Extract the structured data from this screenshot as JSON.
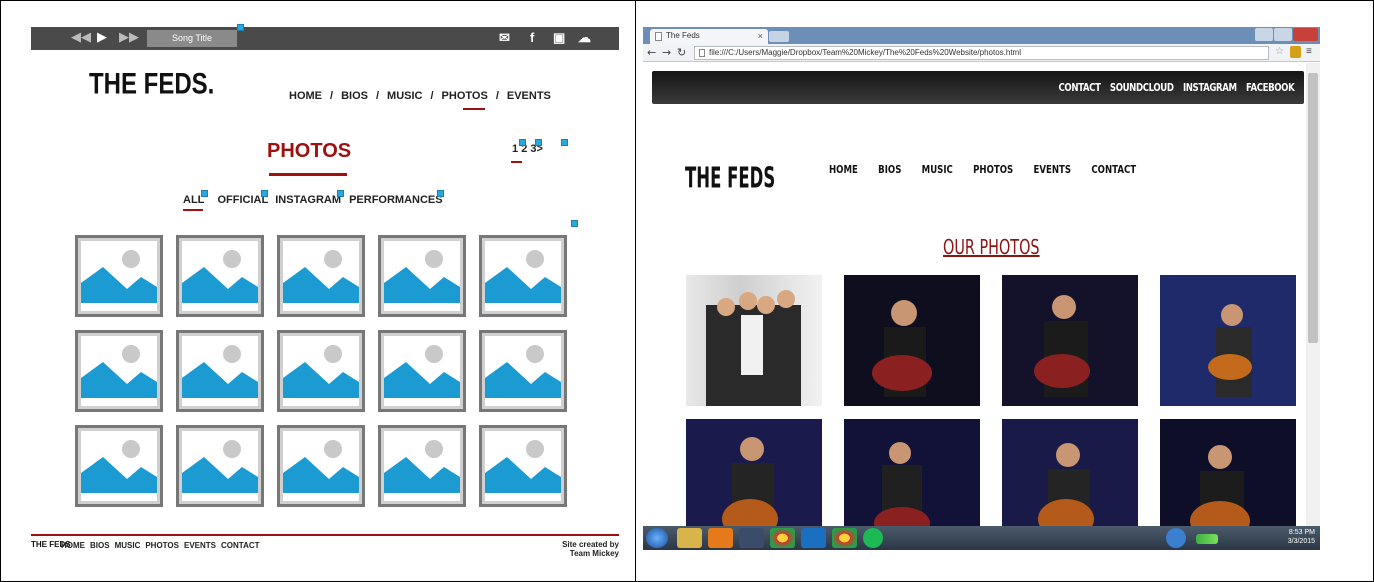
{
  "wireframe": {
    "player": {
      "song_title": "Song Title"
    },
    "logo": "THE FEDS.",
    "nav": [
      "HOME",
      "BIOS",
      "MUSIC",
      "PHOTOS",
      "EVENTS"
    ],
    "nav_separator": "/",
    "title": "PHOTOS",
    "pagination": {
      "pages": [
        "1",
        "2",
        "3"
      ],
      "next": ">"
    },
    "filters": [
      "ALL",
      "OFFICIAL",
      "INSTAGRAM",
      "PERFORMANCES"
    ],
    "footer": {
      "logo": "THE FEDS",
      "nav": [
        "HOME",
        "BIOS",
        "MUSIC",
        "PHOTOS",
        "EVENTS",
        "CONTACT"
      ],
      "credit_line1": "Site created by",
      "credit_line2": "Team Mickey"
    }
  },
  "browser": {
    "tab_title": "The Feds",
    "url": "file:///C:/Users/Maggie/Dropbox/Team%20Mickey/The%20Feds%20Website/photos.html",
    "site": {
      "top_links": [
        "CONTACT",
        "SOUNDCLOUD",
        "INSTAGRAM",
        "FACEBOOK"
      ],
      "logo": "THE FEDS",
      "nav": [
        "HOME",
        "BIOS",
        "MUSIC",
        "PHOTOS",
        "EVENTS",
        "CONTACT"
      ],
      "title": "OUR PHOTOS"
    },
    "taskbar": {
      "time": "8:53 PM",
      "date": "3/3/2015"
    }
  },
  "colors": {
    "accent_red": "#a01010",
    "placeholder_blue": "#1b9bd1",
    "placeholder_gray": "#d0d0d0"
  }
}
